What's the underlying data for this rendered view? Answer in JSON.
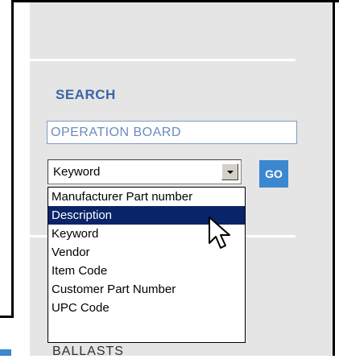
{
  "search": {
    "heading": "SEARCH",
    "input_value": "OPERATION BOARD",
    "select_value": "Keyword",
    "go_label": "GO"
  },
  "dropdown": {
    "options": [
      "Manufacturer Part number",
      "Description",
      "Keyword",
      "Vendor",
      "Item Code",
      "Customer Part Number",
      "UPC Code"
    ],
    "highlighted": "Description"
  },
  "next_section": {
    "heading": "BALLASTS"
  },
  "colors": {
    "sidebar_bg": "#e5e5e5",
    "heading_blue": "#3a64a5",
    "go_button_bg": "#3b87d0",
    "selection_bg": "#0a246a"
  },
  "icons": {
    "dropdown_arrow": "chevron-down-icon",
    "cursor": "mouse-pointer-icon"
  }
}
